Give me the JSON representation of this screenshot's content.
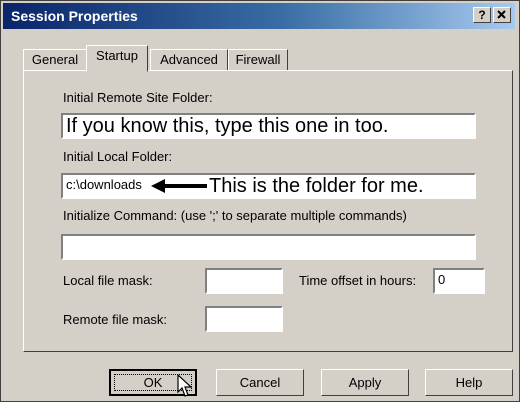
{
  "window": {
    "title": "Session Properties",
    "help_label": "?",
    "close_label": "x"
  },
  "tabs": [
    {
      "label": "General",
      "active": false
    },
    {
      "label": "Startup",
      "active": true
    },
    {
      "label": "Advanced",
      "active": false
    },
    {
      "label": "Firewall",
      "active": false
    }
  ],
  "startup": {
    "remote_folder_label": "Initial Remote Site Folder:",
    "remote_folder_value": "If you know this, type this one in too.",
    "local_folder_label": "Initial Local Folder:",
    "local_folder_value": "c:\\downloads",
    "local_folder_annotation": "This is the folder for me.",
    "init_command_label": "Initialize Command: (use ';' to separate multiple commands)",
    "init_command_value": "",
    "local_mask_label": "Local file mask:",
    "local_mask_value": "",
    "time_offset_label": "Time offset in hours:",
    "time_offset_value": "0",
    "remote_mask_label": "Remote file mask:",
    "remote_mask_value": ""
  },
  "buttons": {
    "ok": "OK",
    "cancel": "Cancel",
    "apply": "Apply",
    "help": "Help"
  },
  "icons": [
    "help-icon",
    "close-icon",
    "arrow-annotation-icon",
    "mouse-cursor-icon"
  ]
}
